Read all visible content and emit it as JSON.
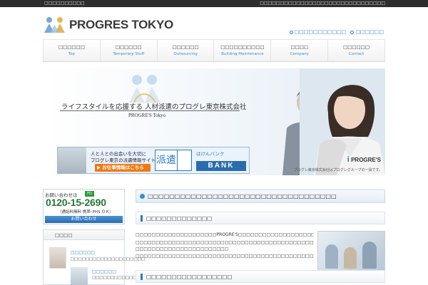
{
  "topbar": {
    "left": "□□□□□□□□□□",
    "right": "□□□□□□□□□□□□□□□□□□□□□□□□□□□□□□□"
  },
  "brand": {
    "name": "PROGRES TOKYO"
  },
  "header_links": [
    "□□□□□□□□□□□",
    "□□□□□□"
  ],
  "nav": [
    {
      "jp": "□□□□□□",
      "en": "Top"
    },
    {
      "jp": "□□□□□□",
      "en": "Temporary Stuff"
    },
    {
      "jp": "□□□□□□",
      "en": "Outsourcing"
    },
    {
      "jp": "□□□□□□□□□□",
      "en": "Building Maintenance"
    },
    {
      "jp": "□□□□",
      "en": "Company"
    },
    {
      "jp": "□□□□□□",
      "en": "Contact"
    }
  ],
  "hero": {
    "tagline": "ライフスタイルを応援する 人材派遣のプログレ東京株式会社",
    "tagsub": "PROGRE'S Tokyo",
    "banner": {
      "line1": "人と人との出会いを大切に",
      "line2": "プログレ東京の派遣情報サイト",
      "button": "▶ お仕事情報はこちら",
      "haken": "派遣",
      "small": "はけんバンク",
      "bank": "BANK"
    },
    "brand2": "PROGRE'S",
    "brand2_prefix": "i",
    "note": "プログレ東京株式会社はプログレグループの一員です。"
  },
  "contact": {
    "label": "お問い合わせは",
    "freedial": "FD",
    "phone": "0120-15-2690",
    "note": "（通話料無料 携帯･PHS ＯＫ）",
    "button": "お問い合わせ"
  },
  "side_news": {
    "title": "□□□□",
    "item1_name": "□□□□□□",
    "item1_desc": "□□□□□□□□□□□□□□□□□□□□",
    "item2_name": "□□□□□□",
    "item2_desc": "□□□□□□□□□□□□□□□□"
  },
  "main": {
    "heading": "□□□□□□□□□□□□□□□□□□□□□□□□□□□□□□□□□□□",
    "subheading": "□□□□□□□□□□□□□",
    "para1": "□□□□□□□□□□□□□□□□□□□□PROGRE'S□□□□□□□□□□□□□□□□□□□□□□□",
    "para2": "□□□□□□□□□□□□□□□□□□□□□□□□□□□□□□□□□□□□□□□□□□□□□□□□□□□□",
    "para3": "□□□□□□□□□□□□□□□□□□□□□□□",
    "para4": "□□□□□□□□□□□□□□□□□□□□□□□□□□□□□□□□□□□□□□□□□□□□□□□□",
    "subheading2": "□□□□□□□□□□□□□□□□□"
  },
  "colors": {
    "accent": "#2a7bc0",
    "phone": "#26763a",
    "cta": "#f07a12"
  }
}
